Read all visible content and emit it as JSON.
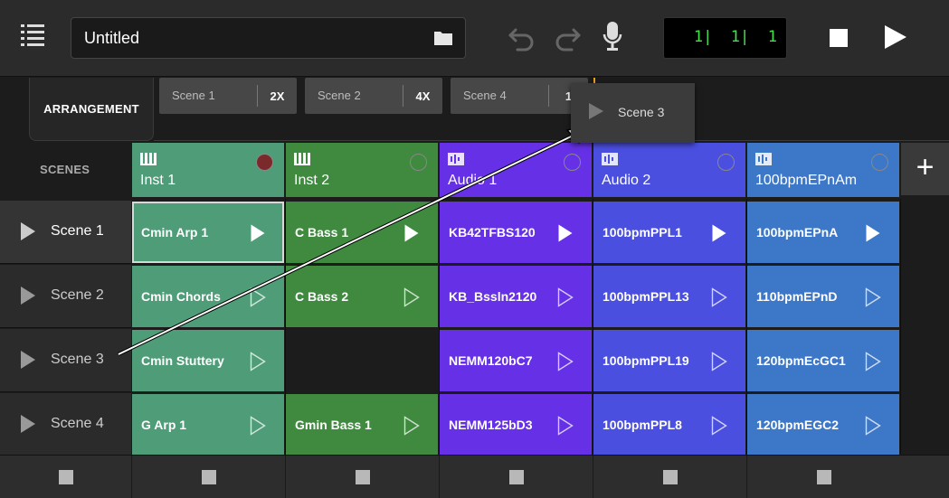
{
  "toolbar": {
    "project_title": "Untitled",
    "counter": {
      "bar": "1",
      "beat": "1",
      "tick": "1"
    },
    "icons": [
      "menu-icon",
      "folder-icon",
      "undo-icon",
      "redo-icon",
      "microphone-icon",
      "stop-icon",
      "play-icon"
    ]
  },
  "arrangement": {
    "tab_label": "ARRANGEMENT",
    "chips": [
      {
        "name": "Scene 1",
        "repeat": "2X"
      },
      {
        "name": "Scene 2",
        "repeat": "4X"
      },
      {
        "name": "Scene 4",
        "repeat": "1"
      }
    ],
    "dragging": {
      "name": "Scene 3"
    }
  },
  "grid": {
    "scenes_label": "SCENES",
    "add_track_label": "+",
    "tracks": [
      {
        "name": "Inst 1",
        "kind": "instrument",
        "color": "#4f9d78"
      },
      {
        "name": "Inst 2",
        "kind": "instrument",
        "color": "#3f8a3f"
      },
      {
        "name": "Audio 1",
        "kind": "audio",
        "color": "#6530e6"
      },
      {
        "name": "Audio 2",
        "kind": "audio",
        "color": "#4a4fe0"
      },
      {
        "name": "100bpmEPnAm",
        "kind": "audio",
        "color": "#3d77c8"
      }
    ],
    "scenes": [
      {
        "name": "Scene 1",
        "active": true
      },
      {
        "name": "Scene 2",
        "active": false
      },
      {
        "name": "Scene 3",
        "active": false
      },
      {
        "name": "Scene 4",
        "active": false
      }
    ],
    "clips": [
      [
        "Cmin Arp 1",
        "C Bass 1",
        "KB42TFBS120",
        "100bpmPPL1",
        "100bpmEPnA"
      ],
      [
        "Cmin Chords",
        "C Bass 2",
        "KB_Bssln2120",
        "100bpmPPL13",
        "110bpmEPnD"
      ],
      [
        "Cmin Stuttery",
        "",
        "NEMM120bC7",
        "100bpmPPL19",
        "120bpmEcGC1"
      ],
      [
        "G Arp 1",
        "Gmin Bass 1",
        "NEMM125bD3",
        "100bpmPPL8",
        "120bpmEGC2"
      ]
    ],
    "playing_row": 0,
    "selected_clip": [
      0,
      0
    ]
  }
}
